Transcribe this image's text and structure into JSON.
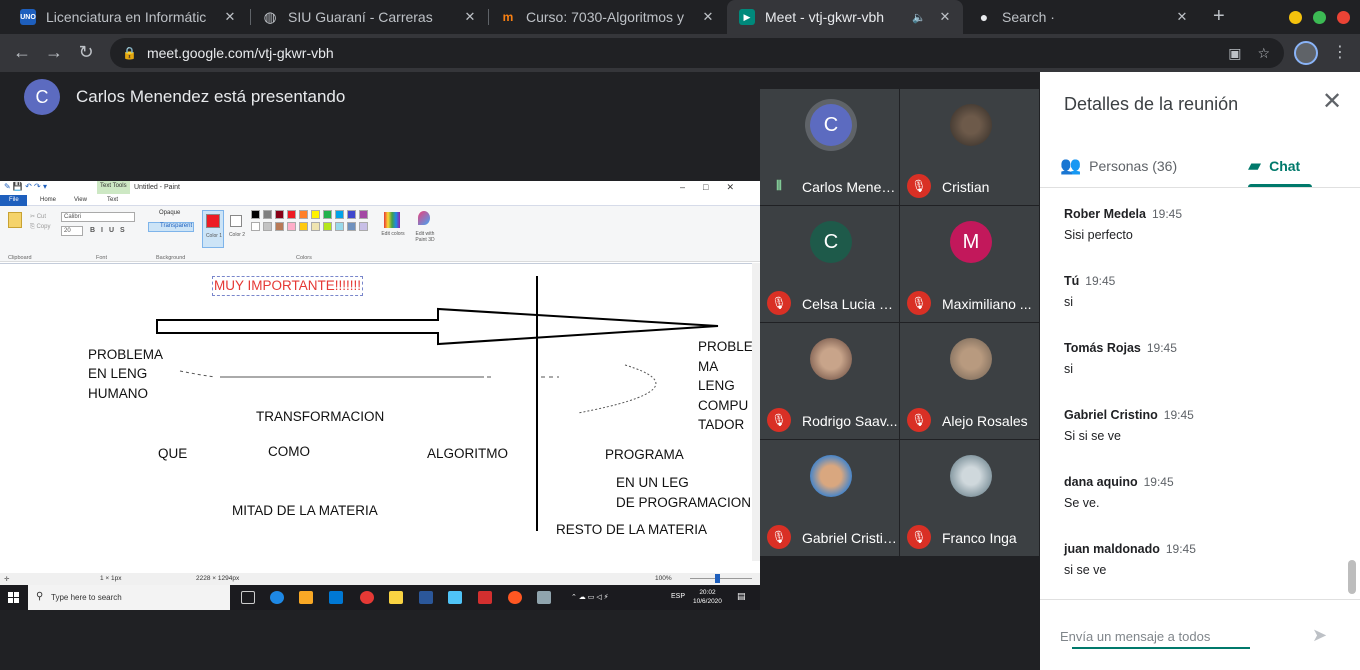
{
  "browser": {
    "tabs": [
      {
        "title": "Licenciatura en Informátic",
        "favicon": "UNO",
        "active": false
      },
      {
        "title": "SIU Guaraní - Carreras",
        "favicon": "globe-icon",
        "active": false
      },
      {
        "title": "Curso: 7030-Algoritmos y",
        "favicon": "moodle-icon",
        "active": false
      },
      {
        "title": "Meet - vtj-gkwr-vbh",
        "favicon": "meet-icon",
        "active": true
      },
      {
        "title": "Search ·",
        "favicon": "github-icon",
        "active": false
      }
    ],
    "url": "meet.google.com/vtj-gkwr-vbh"
  },
  "meet": {
    "presenter_initial": "C",
    "presenter_text": "Carlos Menendez está presentando",
    "participants": [
      {
        "name": "Carlos Menen...",
        "initial": "C",
        "color": "#5c6bc0",
        "muted": false
      },
      {
        "name": "Cristian",
        "initial": "",
        "color": "#6d5a4a",
        "muted": true
      },
      {
        "name": "Celsa Lucia Fr...",
        "initial": "C",
        "color": "#1e5a4a",
        "muted": true
      },
      {
        "name": "Maximiliano ...",
        "initial": "M",
        "color": "#c2185b",
        "muted": true
      },
      {
        "name": "Rodrigo Saav...",
        "initial": "",
        "color": "#8d6e63",
        "muted": true
      },
      {
        "name": "Alejo Rosales",
        "initial": "",
        "color": "#9e8a7a",
        "muted": true
      },
      {
        "name": "Gabriel Cristino",
        "initial": "",
        "color": "#4a86c8",
        "muted": true
      },
      {
        "name": "Franco Inga",
        "initial": "",
        "color": "#90a4ae",
        "muted": true
      }
    ]
  },
  "shared_screen": {
    "window_title": "Untitled - Paint",
    "text_tools": "Text Tools",
    "ribbon_tabs": [
      "File",
      "Home",
      "View",
      "Text"
    ],
    "font_name": "Calibri",
    "font_size": "20",
    "groups": [
      "Clipboard",
      "Font",
      "Background",
      "Colors"
    ],
    "opaque": "Opaque",
    "transparent": "Transparent",
    "color1": "Color 1",
    "color2": "Color 2",
    "edit_colors": "Edit colors",
    "edit_paint3d": "Edit with Paint 3D",
    "canvas_texts": {
      "muy_importante": "MUY IMPORTANTE!!!!!!!",
      "problema_l1": "PROBLEMA",
      "problema_l2": "EN LENG",
      "problema_l3": "HUMANO",
      "transformacion": "TRANSFORMACION",
      "que": "QUE",
      "como": "COMO",
      "algoritmo": "ALGORITMO",
      "mitad": "MITAD DE LA MATERIA",
      "proble_l1": "PROBLE",
      "proble_l2": "MA",
      "proble_l3": "LENG",
      "proble_l4": "COMPU",
      "proble_l5": "TADOR",
      "programa": "PROGRAMA",
      "en_un_leg": "EN UN LEG",
      "de_programacion": "DE PROGRAMACION",
      "resto": "RESTO DE LA MATERIA"
    },
    "status_sel": "1 × 1px",
    "status_size": "2228 × 1294px",
    "zoom": "100%",
    "taskbar_search": "Type here to search",
    "tray_lang": "ESP",
    "clock_time": "20:02",
    "clock_date": "10/6/2020"
  },
  "panel": {
    "title": "Detalles de la reunión",
    "tab_people": "Personas (36)",
    "tab_chat": "Chat",
    "messages": [
      {
        "sender": "Rober Medela",
        "time": "19:45",
        "text": "Sisi perfecto"
      },
      {
        "sender": "Tú",
        "time": "19:45",
        "text": "si"
      },
      {
        "sender": "Tomás Rojas",
        "time": "19:45",
        "text": "si"
      },
      {
        "sender": "Gabriel Cristino",
        "time": "19:45",
        "text": "Si si se ve"
      },
      {
        "sender": "dana aquino",
        "time": "19:45",
        "text": "Se ve."
      },
      {
        "sender": "juan maldonado",
        "time": "19:45",
        "text": "si se ve"
      }
    ],
    "compose_placeholder": "Envía un mensaje a todos"
  },
  "colors": {
    "accent": "#00796b",
    "mic_muted": "#d93025",
    "background": "#202124"
  }
}
